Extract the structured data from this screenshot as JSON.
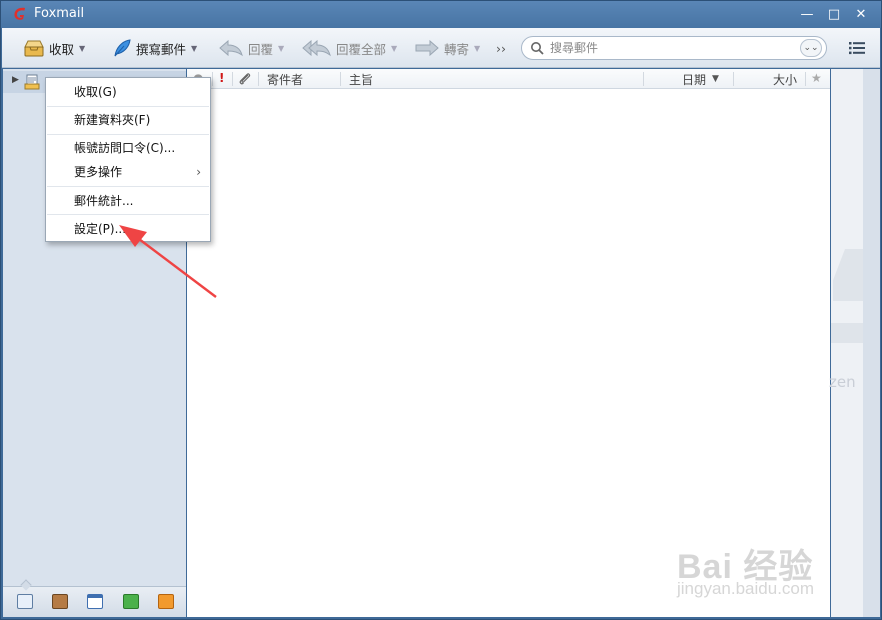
{
  "window": {
    "title": "Foxmail",
    "controls": {
      "minimize": "—",
      "maximize": "□",
      "close": "✕"
    }
  },
  "toolbar": {
    "receive": "收取",
    "compose": "撰寫郵件",
    "reply": "回覆",
    "reply_all": "回覆全部",
    "forward": "轉寄",
    "more": "››"
  },
  "search": {
    "placeholder": "搜尋郵件"
  },
  "list_columns": {
    "flag": "!",
    "sender": "寄件者",
    "subject": "主旨",
    "date": "日期",
    "size": "大小"
  },
  "context_menu": {
    "items": [
      {
        "label": "收取(G)"
      },
      {
        "label": "新建資料夾(F)"
      },
      {
        "label": "帳號訪問口令(C)..."
      },
      {
        "label": "更多操作"
      },
      {
        "label": "郵件統計..."
      },
      {
        "label": "設定(P)..."
      }
    ],
    "submenu_arrow": "›"
  },
  "preview": {
    "ghost_text": "zen"
  },
  "watermark": {
    "brand": "Bai 经验",
    "url": "jingyan.baidu.com"
  },
  "colors": {
    "titlebar": "#4a77a8",
    "annotation_arrow": "#ef4444",
    "accent_logo": "#e0302b",
    "important_mark": "#d01818"
  },
  "icons": {
    "app": "foxmail-logo-icon",
    "receive": "inbox-tray-icon",
    "compose": "feather-quill-icon",
    "reply": "reply-arrow-icon",
    "reply_all": "reply-all-arrow-icon",
    "forward": "forward-arrow-icon",
    "search": "search-icon",
    "menu": "list-menu-icon",
    "bottom_bar": [
      "mail-icon",
      "contacts-icon",
      "calendar-icon",
      "notes-icon",
      "rss-icon"
    ]
  }
}
